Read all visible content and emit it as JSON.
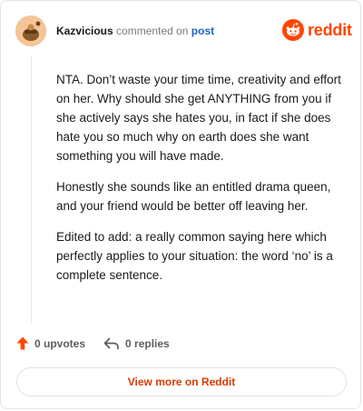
{
  "header": {
    "username": "Kazvicious",
    "commented_on": "commented on",
    "post_link": "post",
    "brand": "reddit"
  },
  "comment": {
    "paragraphs": [
      "NTA. Don’t waste your time time, creativity and effort on her. Why should she get ANYTHING from you if she actively says she hates you, in fact if she does hate you so much why on earth does she want something you will have made.",
      "Honestly she sounds like an entitled drama queen, and your friend would be better off leaving her.",
      "Edited to add: a really common saying here which perfectly applies to your situation: the word ‘no’ is a complete sentence."
    ]
  },
  "actions": {
    "upvotes": "0 upvotes",
    "replies": "0 replies"
  },
  "footer": {
    "view_more": "View more on Reddit"
  },
  "colors": {
    "brand": "#ff4500",
    "link": "#1a64c4",
    "view_more": "#d93a00"
  },
  "icons": [
    "avatar",
    "reddit-logo-icon",
    "upvote-arrow-icon",
    "reply-icon"
  ]
}
